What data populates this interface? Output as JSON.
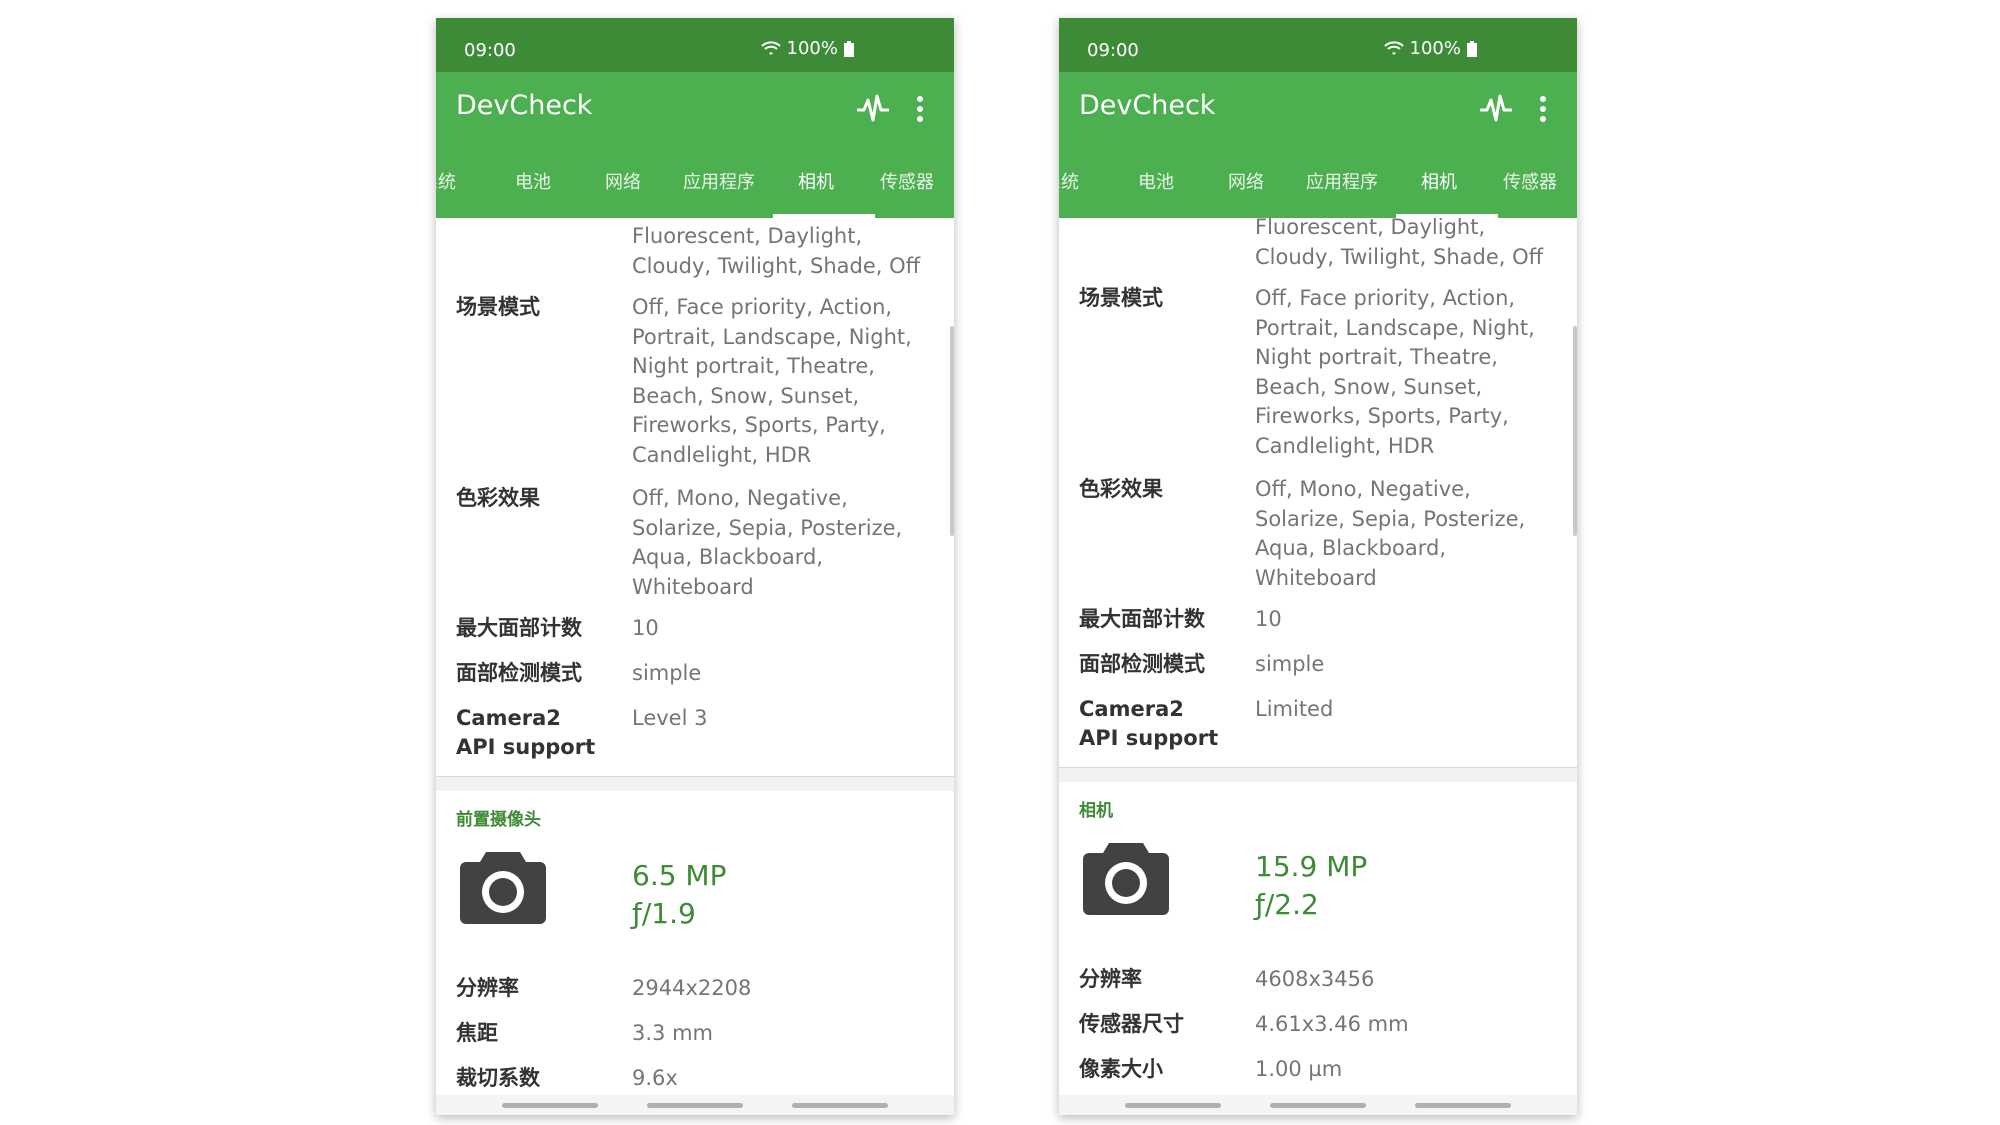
{
  "phones": [
    {
      "status": {
        "time": "09:00",
        "battery": "100%"
      },
      "app_title": "DevCheck",
      "tabs": [
        "系统",
        "电池",
        "网络",
        "应用程序",
        "相机",
        "传感器"
      ],
      "active_tab": "相机",
      "top_value": "Fluorescent, Daylight, Cloudy, Twilight, Shade, Off",
      "rows": [
        {
          "label": "场景模式",
          "value": "Off, Face priority, Action, Portrait, Landscape, Night, Night portrait, Theatre, Beach, Snow, Sunset, Fireworks, Sports, Party, Candlelight, HDR"
        },
        {
          "label": "色彩效果",
          "value": "Off, Mono, Negative, Solarize, Sepia, Posterize, Aqua, Blackboard, Whiteboard"
        },
        {
          "label": "最大面部计数",
          "value": "10"
        },
        {
          "label": "面部检测模式",
          "value": "simple"
        },
        {
          "label": "Camera2 API support",
          "value": "Level 3"
        }
      ],
      "section_title": "前置摄像头",
      "megapixels": "6.5 MP",
      "aperture": "ƒ/1.9",
      "details": [
        {
          "label": "分辨率",
          "value": "2944x2208"
        },
        {
          "label": "焦距",
          "value": "3.3 mm"
        },
        {
          "label": "裁切系数",
          "value": "9.6x"
        }
      ]
    },
    {
      "status": {
        "time": "09:00",
        "battery": "100%"
      },
      "app_title": "DevCheck",
      "tabs": [
        "系统",
        "电池",
        "网络",
        "应用程序",
        "相机",
        "传感器"
      ],
      "active_tab": "相机",
      "top_value": "Fluorescent, Daylight, Cloudy, Twilight, Shade, Off",
      "rows": [
        {
          "label": "场景模式",
          "value": "Off, Face priority, Action, Portrait, Landscape, Night, Night portrait, Theatre, Beach, Snow, Sunset, Fireworks, Sports, Party, Candlelight, HDR"
        },
        {
          "label": "色彩效果",
          "value": "Off, Mono, Negative, Solarize, Sepia, Posterize, Aqua, Blackboard, Whiteboard"
        },
        {
          "label": "最大面部计数",
          "value": "10"
        },
        {
          "label": "面部检测模式",
          "value": "simple"
        },
        {
          "label": "Camera2 API support",
          "value": "Limited"
        }
      ],
      "section_title": "相机",
      "megapixels": "15.9 MP",
      "aperture": "ƒ/2.2",
      "details": [
        {
          "label": "分辨率",
          "value": "4608x3456"
        },
        {
          "label": "传感器尺寸",
          "value": "4.61x3.46 mm"
        },
        {
          "label": "像素大小",
          "value": "1.00 µm"
        }
      ]
    }
  ],
  "colors": {
    "status_bar": "#3d8b37",
    "app_bar": "#4caf50",
    "accent": "#3d8b37"
  },
  "icons": {
    "signal": "pulse-icon",
    "menu": "more-vert-icon",
    "camera": "camera-icon",
    "wifi": "wifi-icon",
    "battery": "battery-icon"
  }
}
